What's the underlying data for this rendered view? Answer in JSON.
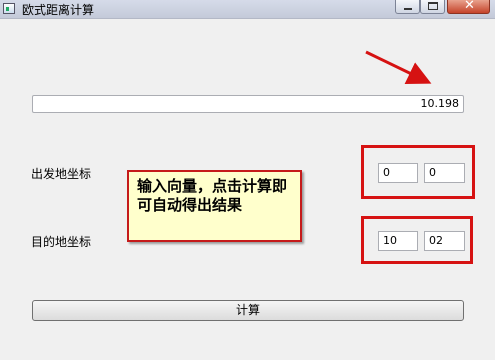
{
  "window": {
    "title": "欧式距离计算",
    "controls": [
      "minimize",
      "maximize",
      "close"
    ]
  },
  "result": {
    "value": "10.198"
  },
  "start": {
    "label": "出发地坐标",
    "x": "0",
    "y": "0"
  },
  "end": {
    "label": "目的地坐标",
    "x": "10",
    "y": "02"
  },
  "callout": {
    "text": "输入向量，点击计算即可自动得出结果"
  },
  "button": {
    "label": "计算"
  },
  "colors": {
    "annotation_red": "#d61212",
    "callout_bg": "#ffffcc"
  }
}
